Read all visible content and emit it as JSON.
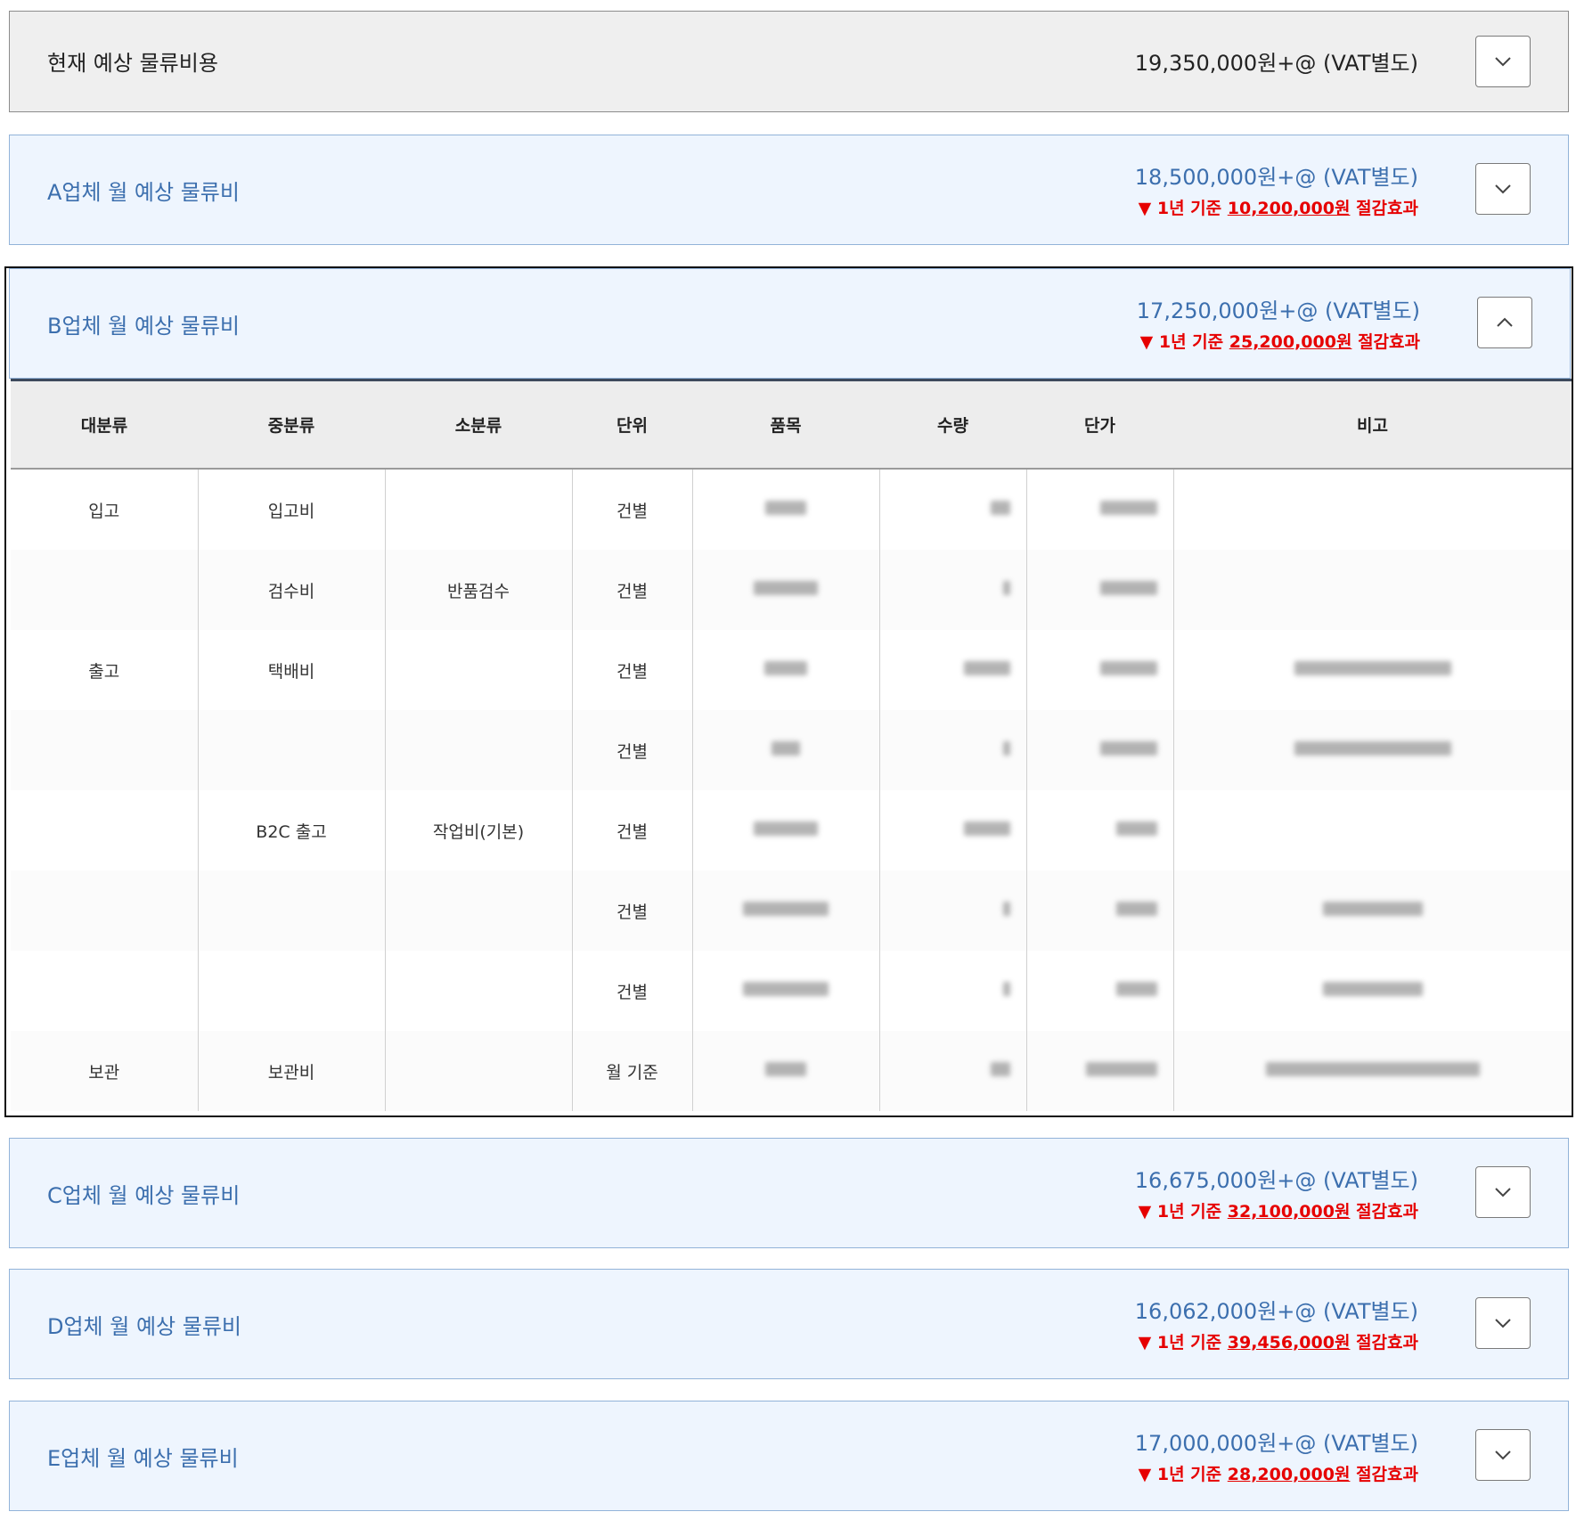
{
  "current": {
    "title": "현재 예상 물류비용",
    "amount": "19,350,000원+@ (VAT별도)"
  },
  "vendors": [
    {
      "title": "A업체 월 예상 물류비",
      "amount": "18,500,000원+@ (VAT별도)",
      "savings_prefix": "▼ 1년 기준",
      "savings_value": "10,200,000원",
      "savings_suffix": "절감효과",
      "expanded": false
    },
    {
      "title": "B업체 월 예상 물류비",
      "amount": "17,250,000원+@ (VAT별도)",
      "savings_prefix": "▼ 1년 기준",
      "savings_value": "25,200,000원",
      "savings_suffix": "절감효과",
      "expanded": true
    },
    {
      "title": "C업체 월 예상 물류비",
      "amount": "16,675,000원+@ (VAT별도)",
      "savings_prefix": "▼ 1년 기준",
      "savings_value": "32,100,000원",
      "savings_suffix": "절감효과",
      "expanded": false
    },
    {
      "title": "D업체 월 예상 물류비",
      "amount": "16,062,000원+@ (VAT별도)",
      "savings_prefix": "▼ 1년 기준",
      "savings_value": "39,456,000원",
      "savings_suffix": "절감효과",
      "expanded": false
    },
    {
      "title": "E업체 월 예상 물류비",
      "amount": "17,000,000원+@ (VAT별도)",
      "savings_prefix": "▼ 1년 기준",
      "savings_value": "28,200,000원",
      "savings_suffix": "절감효과",
      "expanded": false
    }
  ],
  "table": {
    "headers": [
      "대분류",
      "중분류",
      "소분류",
      "단위",
      "품목",
      "수량",
      "단가",
      "비고"
    ],
    "rows": [
      {
        "major": "입고",
        "middle": "입고비",
        "minor": "",
        "unit": "건별"
      },
      {
        "major": "",
        "middle": "검수비",
        "minor": "반품검수",
        "unit": "건별"
      },
      {
        "major": "출고",
        "middle": "택배비",
        "minor": "",
        "unit": "건별"
      },
      {
        "major": "",
        "middle": "",
        "minor": "",
        "unit": "건별"
      },
      {
        "major": "",
        "middle": "B2C 출고",
        "minor": "작업비(기본)",
        "unit": "건별"
      },
      {
        "major": "",
        "middle": "",
        "minor": "",
        "unit": "건별"
      },
      {
        "major": "",
        "middle": "",
        "minor": "",
        "unit": "건별"
      },
      {
        "major": "보관",
        "middle": "보관비",
        "minor": "",
        "unit": "월 기준"
      }
    ]
  },
  "colors": {
    "vendor_blue": "#3c6fae",
    "savings_red": "#e60000",
    "panel_bg": "#eef5fe"
  },
  "icons": {
    "collapsed": "chevron-down-icon",
    "expanded": "chevron-up-icon"
  }
}
